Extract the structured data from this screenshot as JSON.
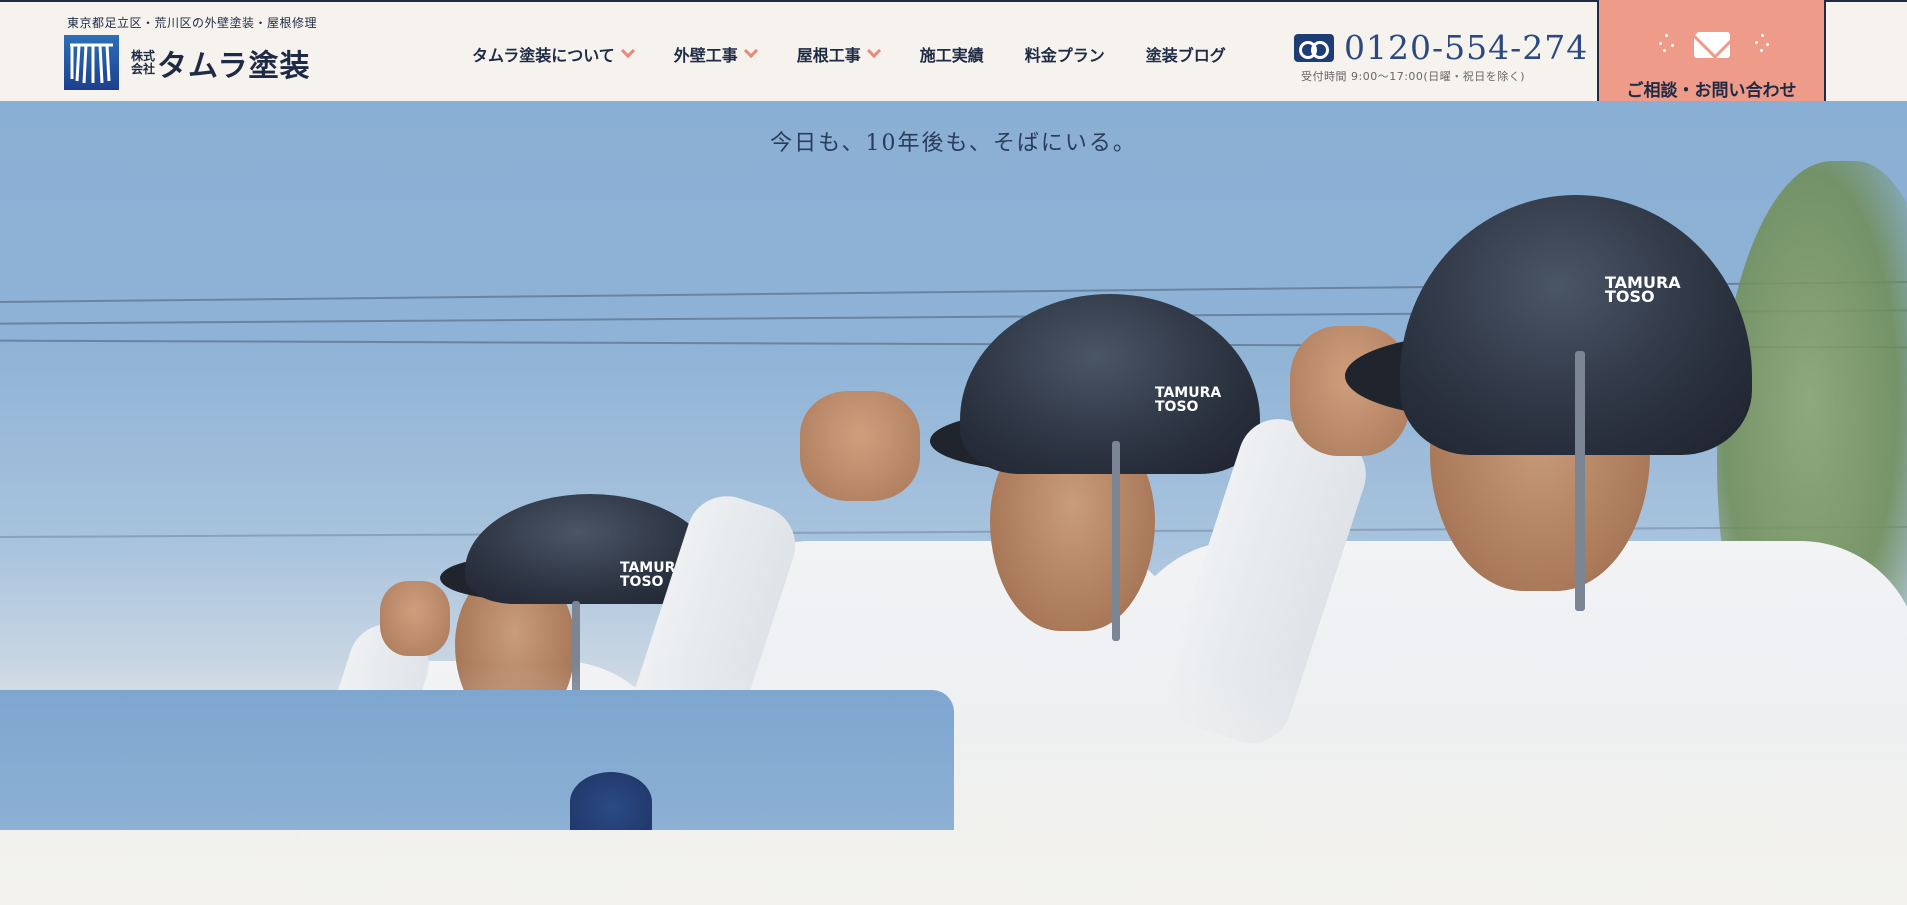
{
  "header": {
    "tagline": "東京都足立区・荒川区の外壁塗装・屋根修理",
    "logo_kaisha": "株式会社",
    "logo_name": "タムラ塗装",
    "nav": [
      {
        "label": "タムラ塗装について",
        "dropdown": true
      },
      {
        "label": "外壁工事",
        "dropdown": true
      },
      {
        "label": "屋根工事",
        "dropdown": true
      },
      {
        "label": "施工実績",
        "dropdown": false
      },
      {
        "label": "料金プラン",
        "dropdown": false
      },
      {
        "label": "塗装ブログ",
        "dropdown": false
      }
    ],
    "phone": {
      "icon": "free-dial-icon",
      "number": "0120-554-274",
      "hours": "受付時間 9:00〜17:00(日曜・祝日を除く)"
    },
    "contact": {
      "icon": "mail-icon",
      "label": "ご相談・お問い合わせ"
    }
  },
  "hero": {
    "catchcopy": "今日も、10年後も、そばにいる。",
    "helmet_brand": "TAMURA TOSO"
  },
  "colors": {
    "navy": "#1f2a44",
    "accent": "#ef9b89",
    "chevron": "#e9897a",
    "phone_blue": "#2c4a80",
    "sky": "#8aafd4"
  }
}
